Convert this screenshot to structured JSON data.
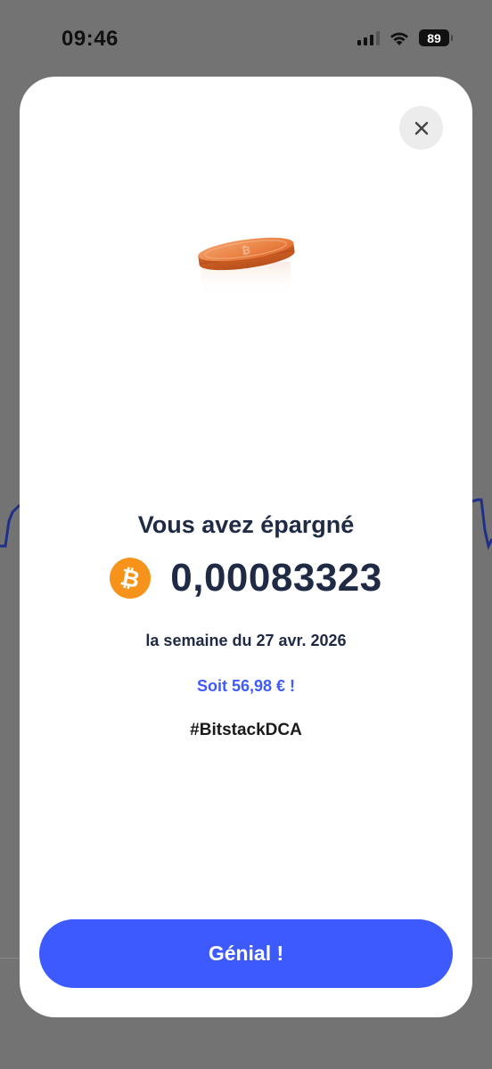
{
  "status_bar": {
    "time": "09:46",
    "battery": "89",
    "icons": [
      "signal-icon",
      "wifi-icon",
      "battery-icon"
    ]
  },
  "modal": {
    "close_icon": "close-icon",
    "illustration": "bitcoin-coin-illustration",
    "title": "Vous avez épargné",
    "amount": "0,00083323",
    "currency_icon": "bitcoin-icon",
    "week_label": "la semaine du 27 avr. 2026",
    "fiat_value": "Soit 56,98 € !",
    "hashtag": "#BitstackDCA",
    "cta_label": "Génial !"
  },
  "colors": {
    "accent": "#3d5afe",
    "bitcoin_orange": "#f7931a",
    "text_dark": "#1f2a44",
    "fiat_blue": "#3f5bff",
    "backdrop": "#737373"
  }
}
